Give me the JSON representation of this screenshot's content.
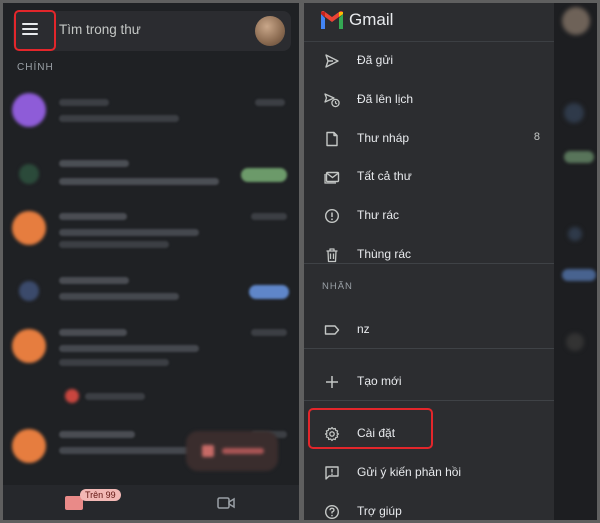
{
  "left_panel": {
    "search": {
      "placeholder": "Tìm trong thư"
    },
    "section_label": "CHÍNH",
    "bottom_nav": {
      "mail_badge": "Trên 99"
    },
    "colors": {
      "highlight": "#e3262b",
      "mail_badge_bg": "#f2b8b5"
    }
  },
  "drawer": {
    "app_name": "Gmail",
    "items": [
      {
        "label": "Đã gửi",
        "icon": "send-icon"
      },
      {
        "label": "Đã lên lịch",
        "icon": "scheduled-send-icon"
      },
      {
        "label": "Thư nháp",
        "icon": "draft-icon",
        "count": "8"
      },
      {
        "label": "Tất cả thư",
        "icon": "all-mail-icon"
      },
      {
        "label": "Thư rác",
        "icon": "spam-icon"
      },
      {
        "label": "Thùng rác",
        "icon": "trash-icon"
      }
    ],
    "labels_heading": "NHÃN",
    "labels": [
      {
        "label": "nz",
        "icon": "label-icon"
      }
    ],
    "create_new": {
      "label": "Tạo mới",
      "icon": "plus-icon"
    },
    "footer_items": [
      {
        "label": "Cài đặt",
        "icon": "settings-icon"
      },
      {
        "label": "Gửi ý kiến phản hồi",
        "icon": "feedback-icon"
      },
      {
        "label": "Trợ giúp",
        "icon": "help-icon"
      }
    ]
  }
}
